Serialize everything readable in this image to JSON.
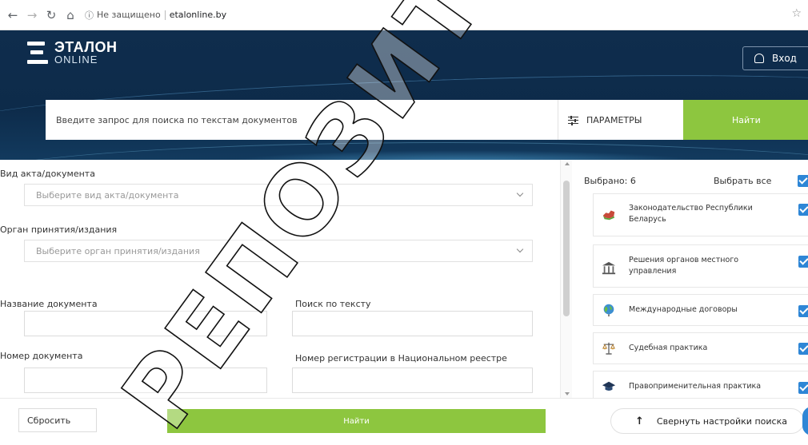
{
  "browser": {
    "security_label": "Не защищено",
    "url": "etalonline.by"
  },
  "header": {
    "logo_line1": "ЭТАЛОН",
    "logo_line2": "ONLINE",
    "login_label": "Вход"
  },
  "search": {
    "placeholder": "Введите запрос для поиска по текстам документов",
    "params_label": "ПАРАМЕТРЫ",
    "find_label": "Найти"
  },
  "form": {
    "doc_type_label": "Вид акта/документа",
    "doc_type_placeholder": "Выберите вид акта/документа",
    "authority_label": "Орган принятия/издания",
    "authority_placeholder": "Выберите орган принятия/издания",
    "doc_name_label": "Название документа",
    "text_search_label": "Поиск по тексту",
    "doc_number_label": "Номер документа",
    "registry_label": "Номер регистрации в Национальном реестре"
  },
  "panel": {
    "selected_count": "Выбрано: 6",
    "select_all": "Выбрать все",
    "categories": [
      {
        "line1": "Законодательство Республики",
        "line2": "Беларусь",
        "icon": "belarus-map-icon",
        "checked": true
      },
      {
        "line1": "Решения органов местного",
        "line2": "управления",
        "icon": "government-building-icon",
        "checked": true
      },
      {
        "line1": "Международные договоры",
        "line2": "",
        "icon": "globe-icon",
        "checked": true
      },
      {
        "line1": "Судебная практика",
        "line2": "",
        "icon": "scales-icon",
        "checked": true
      },
      {
        "line1": "Правоприменительная практика",
        "line2": "",
        "icon": "graduation-cap-icon",
        "checked": true
      }
    ]
  },
  "actions": {
    "reset_label": "Сбросить",
    "find_label": "Найти",
    "collapse_label": "Свернуть настройки поиска"
  },
  "watermark": {
    "text": "РЕПОЗИТОРИЙ"
  },
  "colors": {
    "header_bg": "#0f2d4d",
    "accent_green": "#8dc63f",
    "checkbox_blue": "#2e86d6"
  }
}
